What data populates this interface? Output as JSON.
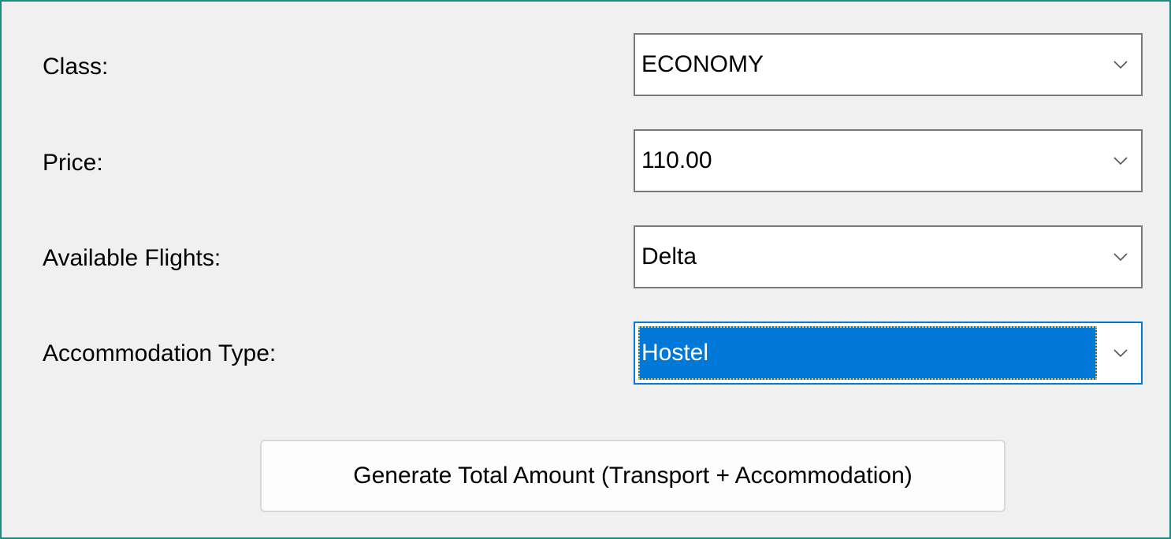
{
  "form": {
    "fields": [
      {
        "label": "Class:",
        "value": "ECONOMY"
      },
      {
        "label": "Price:",
        "value": "110.00"
      },
      {
        "label": "Available Flights:",
        "value": "Delta"
      },
      {
        "label": "Accommodation Type:",
        "value": "Hostel"
      }
    ],
    "focused_field": "Accommodation Type:",
    "generate_button_label": "Generate Total Amount (Transport + Accommodation)"
  },
  "icons": {
    "dropdown": "chevron-down-icon"
  },
  "colors": {
    "frame_border": "#1f8a80",
    "background": "#f0f0f0",
    "selection_highlight": "#0078d7",
    "focus_border": "#0078d7",
    "combo_border": "#7a7a7a"
  }
}
